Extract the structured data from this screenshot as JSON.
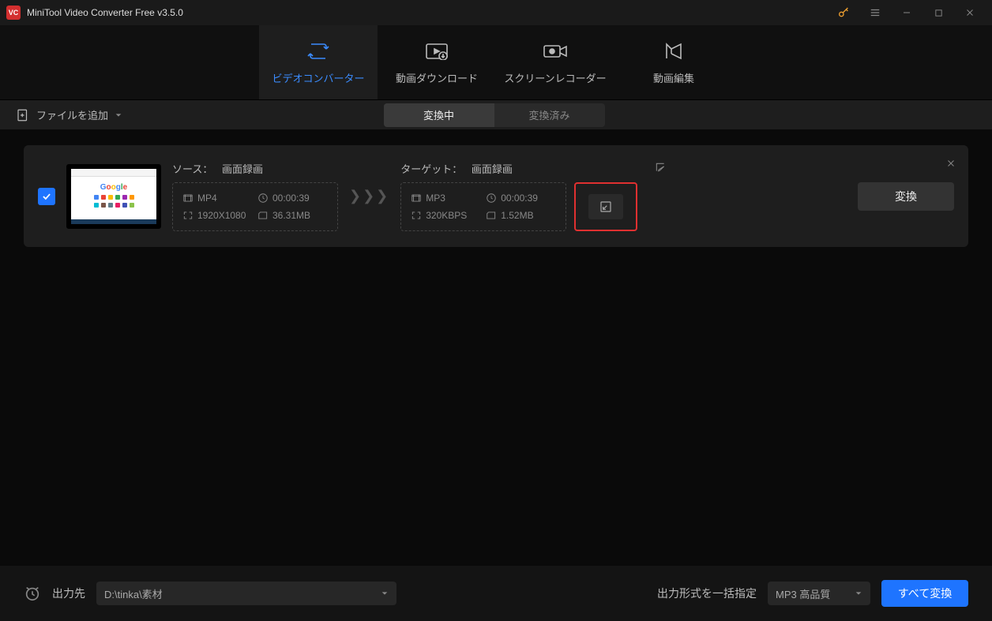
{
  "app": {
    "title": "MiniTool Video Converter Free v3.5.0"
  },
  "nav": {
    "tabs": [
      {
        "label": "ビデオコンバーター"
      },
      {
        "label": "動画ダウンロード"
      },
      {
        "label": "スクリーンレコーダー"
      },
      {
        "label": "動画編集"
      }
    ]
  },
  "toolbar": {
    "add_file": "ファイルを追加",
    "status_tabs": [
      "変換中",
      "変換済み"
    ]
  },
  "item": {
    "source_label": "ソース：",
    "source_name": "画面録画",
    "source": {
      "format": "MP4",
      "duration": "00:00:39",
      "resolution": "1920X1080",
      "size": "36.31MB"
    },
    "target_label": "ターゲット：",
    "target_name": "画面録画",
    "target": {
      "format": "MP3",
      "duration": "00:00:39",
      "bitrate": "320KBPS",
      "size": "1.52MB"
    },
    "convert_btn": "変換"
  },
  "footer": {
    "out_label": "出力先",
    "out_path": "D:\\tinka\\素材",
    "batch_label": "出力形式を一括指定",
    "format_preset": "MP3 高品質",
    "convert_all": "すべて変換"
  }
}
